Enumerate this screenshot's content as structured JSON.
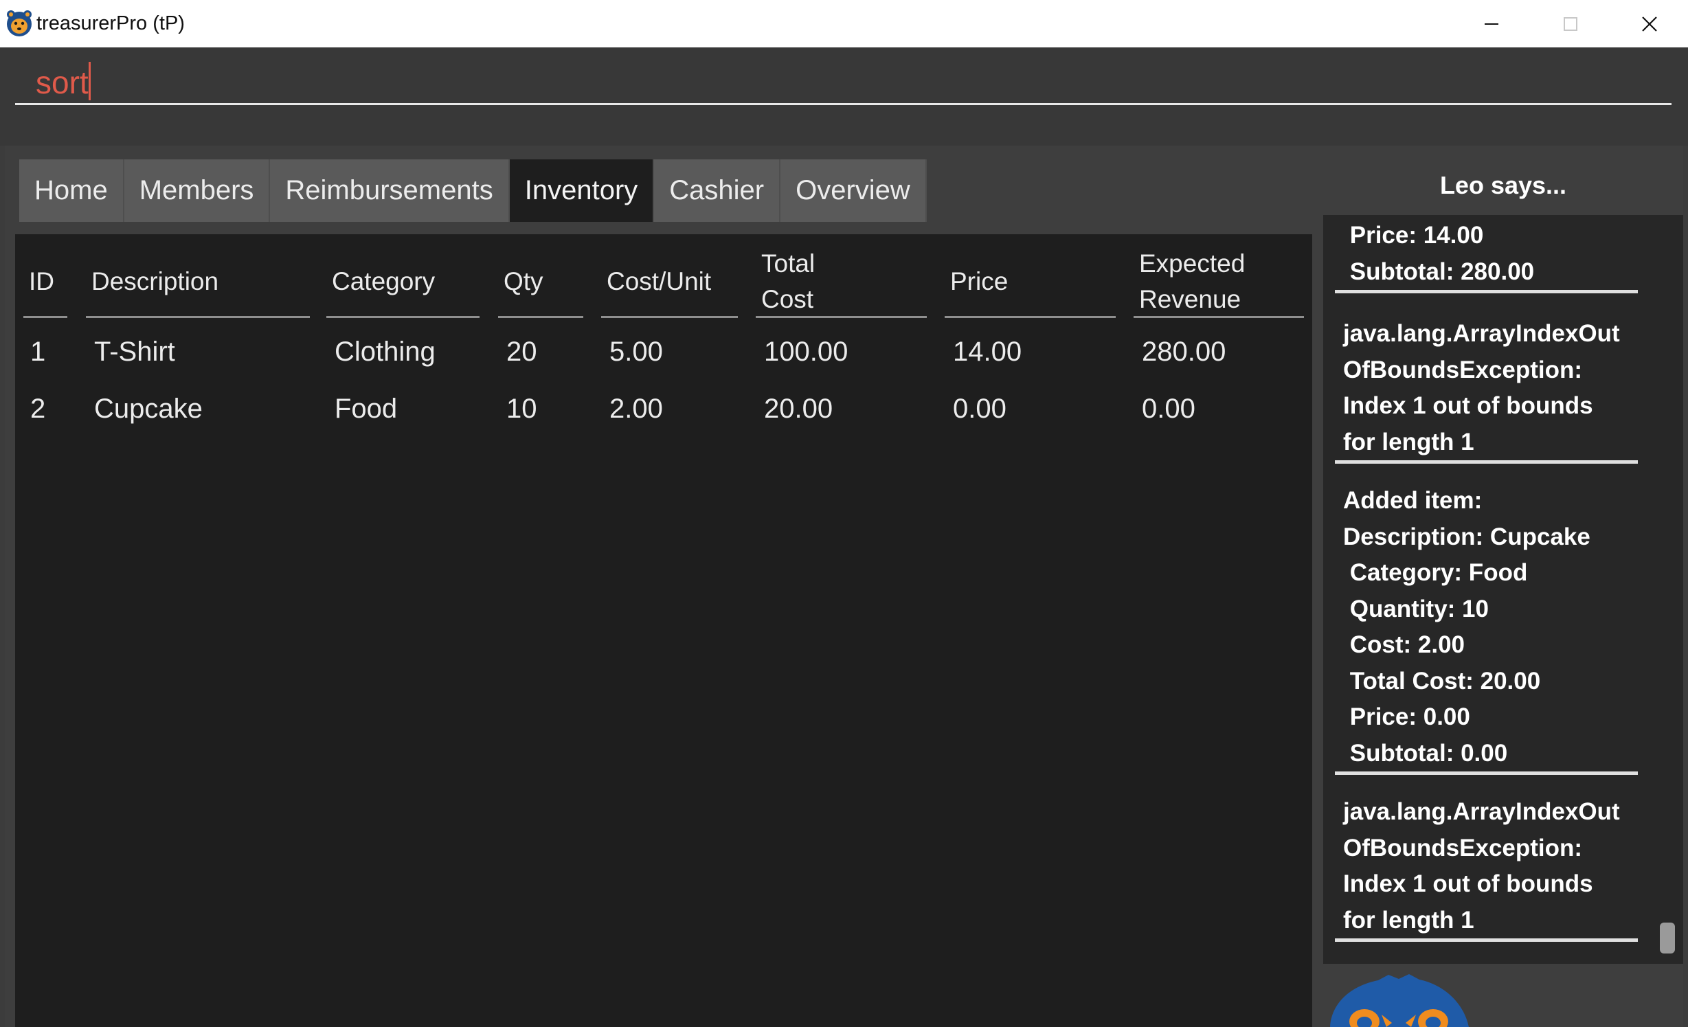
{
  "window": {
    "title": "treasurerPro (tP)",
    "app_icon": "bear-logo-icon",
    "controls": [
      "minimize-icon",
      "maximize-icon",
      "close-icon"
    ]
  },
  "command": {
    "value": "sort"
  },
  "tabs": [
    {
      "label": "Home",
      "selected": false
    },
    {
      "label": "Members",
      "selected": false
    },
    {
      "label": "Reimbursements",
      "selected": false
    },
    {
      "label": "Inventory",
      "selected": true
    },
    {
      "label": "Cashier",
      "selected": false
    },
    {
      "label": "Overview",
      "selected": false
    }
  ],
  "inventory_table": {
    "headers": {
      "id": "ID",
      "description": "Description",
      "category": "Category",
      "qty": "Qty",
      "cost_unit": "Cost/Unit",
      "total_cost_1": "Total",
      "total_cost_2": "Cost",
      "price": "Price",
      "expected_revenue_1": "Expected",
      "expected_revenue_2": "Revenue"
    },
    "rows": [
      {
        "id": "1",
        "description": "T-Shirt",
        "category": "Clothing",
        "qty": "20",
        "cost_unit": "5.00",
        "total_cost": "100.00",
        "price": "14.00",
        "expected_revenue": "280.00"
      },
      {
        "id": "2",
        "description": "Cupcake",
        "category": "Food",
        "qty": "10",
        "cost_unit": "2.00",
        "total_cost": "20.00",
        "price": "0.00",
        "expected_revenue": "0.00"
      }
    ]
  },
  "leo": {
    "title": "Leo says...",
    "messages": [
      {
        "lines": [
          " Price: 14.00",
          " Subtotal: 280.00"
        ]
      },
      {
        "lines": [
          "java.lang.ArrayIndexOut",
          "OfBoundsException:",
          "Index 1 out of bounds",
          "for length 1"
        ]
      },
      {
        "lines": [
          "Added item:",
          "Description: Cupcake",
          " Category: Food",
          " Quantity: 10",
          " Cost: 2.00",
          " Total Cost: 20.00",
          " Price: 0.00",
          " Subtotal: 0.00"
        ]
      },
      {
        "lines": [
          "java.lang.ArrayIndexOut",
          "OfBoundsException:",
          "Index 1 out of bounds",
          "for length 1"
        ]
      }
    ],
    "mascot": "leo-lion-mascot-icon"
  },
  "colors": {
    "command_text": "#e05a4a",
    "background": "#3c3c3c",
    "table_background": "#1e1e1e",
    "tab_selected": "#1e1e1e",
    "tab_normal": "#5a5a5a",
    "mascot_blue": "#1f5ba8",
    "mascot_orange": "#f08c1e"
  }
}
